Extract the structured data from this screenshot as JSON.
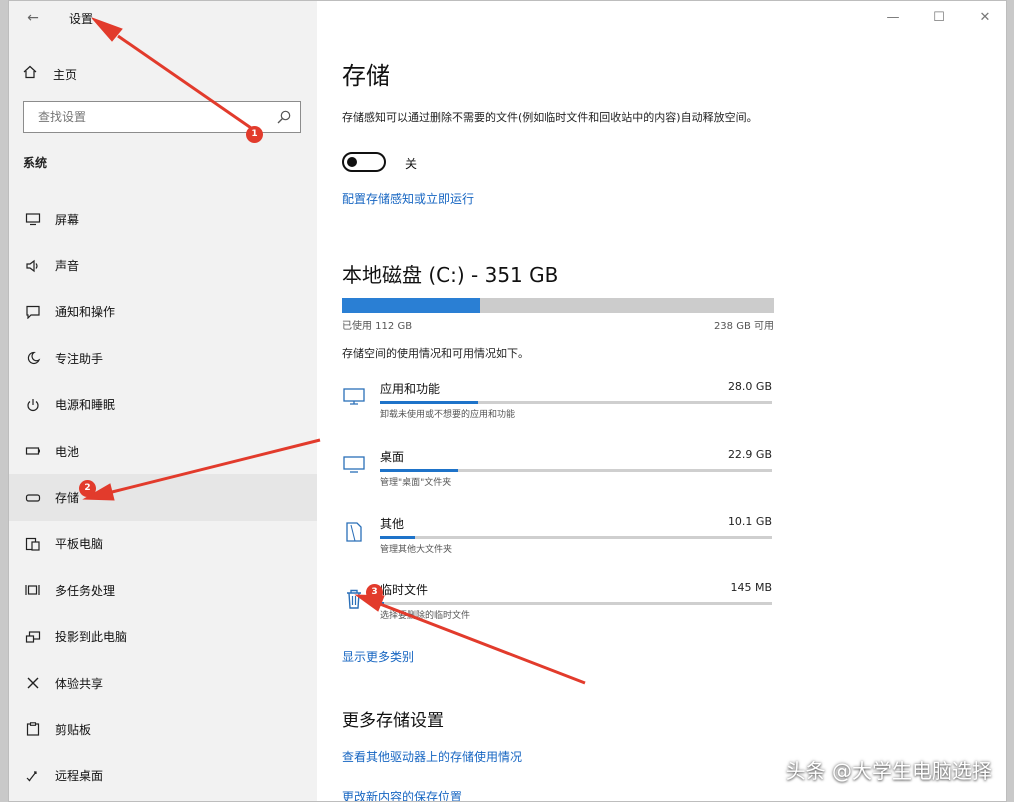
{
  "window": {
    "title": "设置",
    "back_label": "←",
    "minimize_label": "—",
    "maximize_label": "☐",
    "close_label": "✕"
  },
  "sidebar": {
    "home_label": "主页",
    "search_placeholder": "查找设置",
    "section_title": "系统",
    "items": [
      {
        "label": "屏幕",
        "icon": "monitor-icon"
      },
      {
        "label": "声音",
        "icon": "speaker-icon"
      },
      {
        "label": "通知和操作",
        "icon": "notification-icon"
      },
      {
        "label": "专注助手",
        "icon": "moon-icon"
      },
      {
        "label": "电源和睡眠",
        "icon": "power-icon"
      },
      {
        "label": "电池",
        "icon": "battery-icon"
      },
      {
        "label": "存储",
        "icon": "storage-icon"
      },
      {
        "label": "平板电脑",
        "icon": "tablet-icon"
      },
      {
        "label": "多任务处理",
        "icon": "multitask-icon"
      },
      {
        "label": "投影到此电脑",
        "icon": "project-icon"
      },
      {
        "label": "体验共享",
        "icon": "share-icon"
      },
      {
        "label": "剪贴板",
        "icon": "clipboard-icon"
      },
      {
        "label": "远程桌面",
        "icon": "remote-icon"
      }
    ]
  },
  "storage": {
    "title": "存储",
    "description": "存储感知可以通过删除不需要的文件(例如临时文件和回收站中的内容)自动释放空间。",
    "toggle_state": "关",
    "toggle_on": false,
    "configure_link": "配置存储感知或立即运行",
    "drive_title": "本地磁盘 (C:) - 351 GB",
    "used_label": "已使用 112 GB",
    "available_label": "238 GB 可用",
    "used_fraction": 0.32,
    "usage_note": "存储空间的使用情况和可用情况如下。",
    "categories": [
      {
        "name": "应用和功能",
        "size": "28.0 GB",
        "sub": "卸载未使用或不想要的应用和功能",
        "fraction": 0.25,
        "icon": "apps-icon"
      },
      {
        "name": "桌面",
        "size": "22.9 GB",
        "sub": "管理\"桌面\"文件夹",
        "fraction": 0.2,
        "icon": "desktop-icon"
      },
      {
        "name": "其他",
        "size": "10.1 GB",
        "sub": "管理其他大文件夹",
        "fraction": 0.09,
        "icon": "other-icon"
      },
      {
        "name": "临时文件",
        "size": "145 MB",
        "sub": "选择要删除的临时文件",
        "fraction": 0.01,
        "icon": "trash-icon"
      }
    ],
    "show_more_link": "显示更多类别",
    "more_title": "更多存储设置",
    "other_drives_link": "查看其他驱动器上的存储使用情况",
    "partial_link": "更改新内容的保存位置"
  },
  "annotations": {
    "badges": [
      "1",
      "2",
      "3"
    ],
    "arrow_color": "#e23b2c"
  },
  "watermark": "头条 @大学生电脑选择"
}
